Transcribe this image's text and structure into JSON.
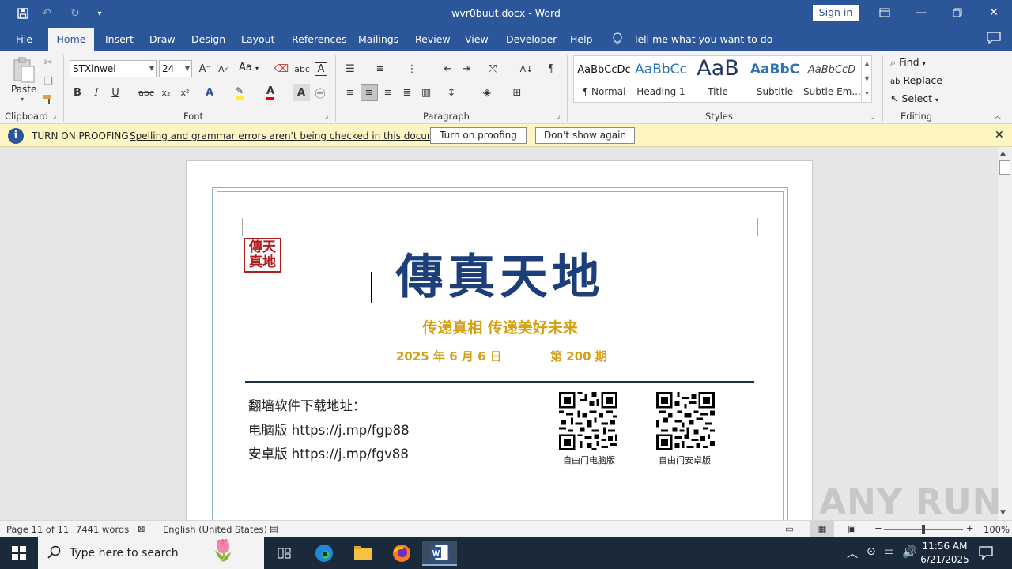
{
  "titlebar": {
    "doc_title": "wvr0buut.docx - Word",
    "sign_in": "Sign in"
  },
  "tabs": [
    "File",
    "Home",
    "Insert",
    "Draw",
    "Design",
    "Layout",
    "References",
    "Mailings",
    "Review",
    "View",
    "Developer",
    "Help"
  ],
  "tell_me": "Tell me what you want to do",
  "ribbon": {
    "clipboard": {
      "paste": "Paste",
      "label": "Clipboard"
    },
    "font": {
      "name": "STXinwei",
      "size": "24",
      "label": "Font",
      "aa_label": "Aa"
    },
    "paragraph": {
      "label": "Paragraph"
    },
    "styles": {
      "label": "Styles",
      "items": [
        {
          "preview": "AaBbCcDc",
          "label": "¶ Normal"
        },
        {
          "preview": "AaBbCc",
          "label": "Heading 1"
        },
        {
          "preview": "AaB",
          "label": "Title"
        },
        {
          "preview": "AaBbC",
          "label": "Subtitle"
        },
        {
          "preview": "AaBbCcD",
          "label": "Subtle Em..."
        }
      ]
    },
    "editing": {
      "label": "Editing",
      "find": "Find",
      "replace": "Replace",
      "select": "Select"
    }
  },
  "infobar": {
    "title": "TURN ON PROOFING",
    "message": "Spelling and grammar errors aren't being checked in this document.",
    "btn_turn_on": "Turn on proofing",
    "btn_dont_show": "Don't show again"
  },
  "document": {
    "seal_text": "傳天真地",
    "masthead": "傳真天地",
    "tagline": "传递真相  传递美好未来",
    "date": "2025 年 6 月 6 日",
    "issue": "第 200 期",
    "download_title": "翻墙软件下载地址：",
    "pc_line": "电脑版 https://j.mp/fgp88",
    "android_line": "安卓版 https://j.mp/fgv88",
    "qr_pc_caption": "自由门电脑版",
    "qr_android_caption": "自由门安卓版"
  },
  "statusbar": {
    "page": "Page 11 of 11",
    "words": "7441 words",
    "language": "English (United States)",
    "zoom": "100%"
  },
  "taskbar": {
    "search_placeholder": "Type here to search",
    "time": "11:56 AM",
    "date": "6/21/2025"
  },
  "watermark": "ANY RUN",
  "colors": {
    "word_blue": "#2b579a",
    "gold": "#d4a017",
    "masthead": "#1c3f7a"
  }
}
